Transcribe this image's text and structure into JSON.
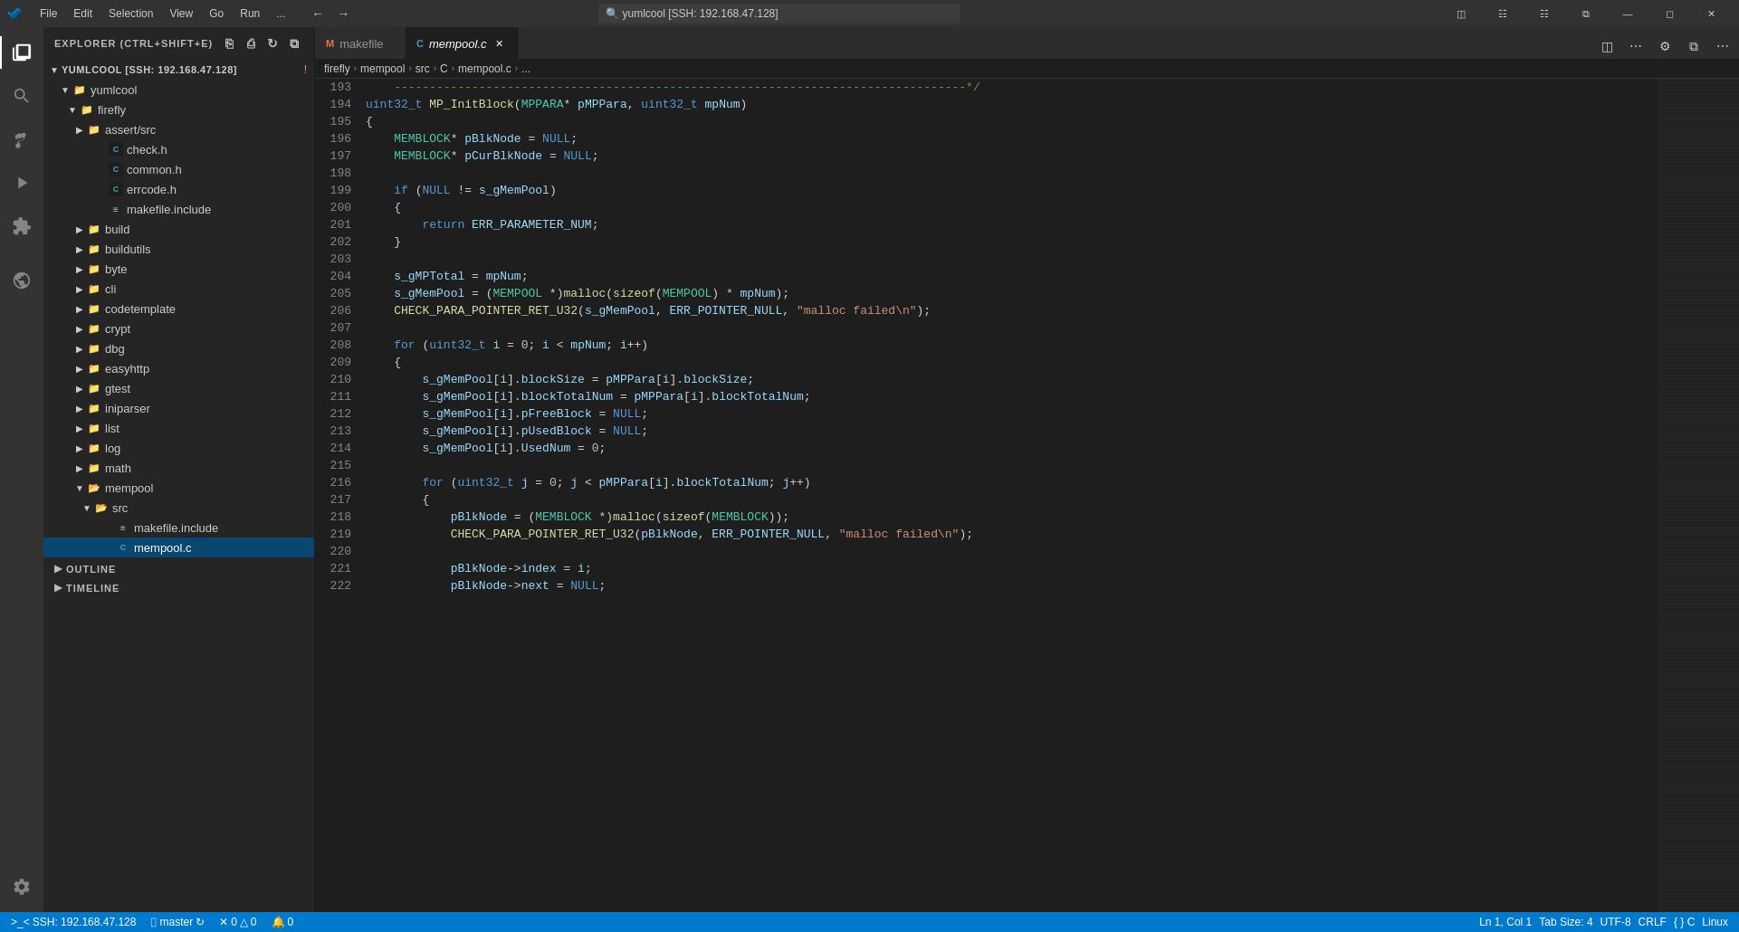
{
  "titlebar": {
    "app_icon": "VSCode",
    "menu": [
      "File",
      "Edit",
      "Selection",
      "View",
      "Go",
      "Run",
      "..."
    ],
    "search_text": "yumlcool [SSH: 192.168.47.128]",
    "window_controls": [
      "minimize",
      "maximize",
      "restore",
      "close"
    ]
  },
  "activity_bar": {
    "icons": [
      "explorer",
      "search",
      "source-control",
      "run-debug",
      "extensions",
      "remote-explorer",
      "settings"
    ]
  },
  "sidebar": {
    "title": "Explorer (Ctrl+Shift+E)",
    "root": "YUMLCOOL [SSH: 192.168.47.128]",
    "actions": [
      "new-file",
      "new-folder",
      "refresh",
      "collapse"
    ],
    "tree": [
      {
        "label": "yumlcool",
        "type": "folder",
        "expanded": true,
        "depth": 1
      },
      {
        "label": "firefly",
        "type": "folder",
        "expanded": true,
        "depth": 2
      },
      {
        "label": "assert/src",
        "type": "folder",
        "expanded": false,
        "depth": 3
      },
      {
        "label": "check.h",
        "type": "c-file",
        "depth": 4
      },
      {
        "label": "common.h",
        "type": "c-file",
        "depth": 4
      },
      {
        "label": "errcode.h",
        "type": "c-file",
        "depth": 4
      },
      {
        "label": "makefile.include",
        "type": "makefile",
        "depth": 4
      },
      {
        "label": "build",
        "type": "folder",
        "expanded": false,
        "depth": 3
      },
      {
        "label": "buildutils",
        "type": "folder",
        "expanded": false,
        "depth": 3
      },
      {
        "label": "byte",
        "type": "folder",
        "expanded": false,
        "depth": 3
      },
      {
        "label": "cli",
        "type": "folder",
        "expanded": false,
        "depth": 3
      },
      {
        "label": "codetemplate",
        "type": "folder",
        "expanded": false,
        "depth": 3
      },
      {
        "label": "crypt",
        "type": "folder",
        "expanded": false,
        "depth": 3
      },
      {
        "label": "dbg",
        "type": "folder",
        "expanded": false,
        "depth": 3
      },
      {
        "label": "easyhttp",
        "type": "folder",
        "expanded": false,
        "depth": 3
      },
      {
        "label": "gtest",
        "type": "folder",
        "expanded": false,
        "depth": 3
      },
      {
        "label": "iniparser",
        "type": "folder",
        "expanded": false,
        "depth": 3
      },
      {
        "label": "list",
        "type": "folder",
        "expanded": false,
        "depth": 3
      },
      {
        "label": "log",
        "type": "folder",
        "expanded": false,
        "depth": 3
      },
      {
        "label": "math",
        "type": "folder",
        "expanded": false,
        "depth": 3
      },
      {
        "label": "mempool",
        "type": "folder",
        "expanded": true,
        "depth": 3
      },
      {
        "label": "src",
        "type": "folder",
        "expanded": true,
        "depth": 4
      },
      {
        "label": "makefile.include",
        "type": "makefile",
        "depth": 5
      },
      {
        "label": "mempool.c",
        "type": "c-file",
        "depth": 5,
        "selected": true
      }
    ],
    "outline": "OUTLINE",
    "timeline": "TIMELINE"
  },
  "tabs": [
    {
      "label": "makefile",
      "icon": "M",
      "active": false,
      "closeable": true
    },
    {
      "label": "mempool.c",
      "icon": "C",
      "active": true,
      "closeable": true
    }
  ],
  "breadcrumb": [
    "firefly",
    "mempool",
    "src",
    "C",
    "mempool.c",
    "..."
  ],
  "editor": {
    "lines": [
      {
        "num": 193,
        "code": "    <cm>---------------------------------------------------------------------------------*/</cm>"
      },
      {
        "num": 194,
        "code": "<kw>uint32_t</kw> <fn>MP_InitBlock</fn>(<ty>MPPARA</ty>* <vr>pMPPara</vr>, <kw>uint32_t</kw> <vr>mpNum</vr>)"
      },
      {
        "num": 195,
        "code": "{"
      },
      {
        "num": 196,
        "code": "    <ty>MEMBLOCK</ty>* <vr>pBlkNode</vr> = <kw>NULL</kw>;"
      },
      {
        "num": 197,
        "code": "    <ty>MEMBLOCK</ty>* <vr>pCurBlkNode</vr> = <kw>NULL</kw>;"
      },
      {
        "num": 198,
        "code": ""
      },
      {
        "num": 199,
        "code": "    <kw>if</kw> (<kw>NULL</kw> != <vr>s_gMemPool</vr>)"
      },
      {
        "num": 200,
        "code": "    {"
      },
      {
        "num": 201,
        "code": "        <kw>return</kw> <vr>ERR_PARAMETER_NUM</vr>;"
      },
      {
        "num": 202,
        "code": "    }"
      },
      {
        "num": 203,
        "code": ""
      },
      {
        "num": 204,
        "code": "    <vr>s_gMPTotal</vr> = <vr>mpNum</vr>;"
      },
      {
        "num": 205,
        "code": "    <vr>s_gMemPool</vr> = (<ty>MEMPOOL</ty> *)<fn>malloc</fn>(<fn>sizeof</fn>(<ty>MEMPOOL</ty>) * <vr>mpNum</vr>);"
      },
      {
        "num": 206,
        "code": "    <mac>CHECK_PARA_POINTER_RET_U32</mac>(<vr>s_gMemPool</vr>, <vr>ERR_POINTER_NULL</vr>, <str>\"malloc failed\\n\"</str>);"
      },
      {
        "num": 207,
        "code": ""
      },
      {
        "num": 208,
        "code": "    <kw>for</kw> (<kw>uint32_t</kw> <vr>i</vr> = <num>0</num>; <vr>i</vr> &lt; <vr>mpNum</vr>; <vr>i</vr>++)"
      },
      {
        "num": 209,
        "code": "    {"
      },
      {
        "num": 210,
        "code": "        <vr>s_gMemPool</vr>[<vr>i</vr>].<vr>blockSize</vr> = <vr>pMPPara</vr>[<vr>i</vr>].<vr>blockSize</vr>;"
      },
      {
        "num": 211,
        "code": "        <vr>s_gMemPool</vr>[<vr>i</vr>].<vr>blockTotalNum</vr> = <vr>pMPPara</vr>[<vr>i</vr>].<vr>blockTotalNum</vr>;"
      },
      {
        "num": 212,
        "code": "        <vr>s_gMemPool</vr>[<vr>i</vr>].<vr>pFreeBlock</vr> = <kw>NULL</kw>;"
      },
      {
        "num": 213,
        "code": "        <vr>s_gMemPool</vr>[<vr>i</vr>].<vr>pUsedBlock</vr> = <kw>NULL</kw>;"
      },
      {
        "num": 214,
        "code": "        <vr>s_gMemPool</vr>[<vr>i</vr>].<vr>UsedNum</vr> = <num>0</num>;"
      },
      {
        "num": 215,
        "code": ""
      },
      {
        "num": 216,
        "code": "        <kw>for</kw> (<kw>uint32_t</kw> <vr>j</vr> = <num>0</num>; <vr>j</vr> &lt; <vr>pMPPara</vr>[<vr>i</vr>].<vr>blockTotalNum</vr>; <vr>j</vr>++)"
      },
      {
        "num": 217,
        "code": "        {"
      },
      {
        "num": 218,
        "code": "            <vr>pBlkNode</vr> = (<ty>MEMBLOCK</ty> *)<fn>malloc</fn>(<fn>sizeof</fn>(<ty>MEMBLOCK</ty>));"
      },
      {
        "num": 219,
        "code": "            <mac>CHECK_PARA_POINTER_RET_U32</mac>(<vr>pBlkNode</vr>, <vr>ERR_POINTER_NULL</vr>, <str>\"malloc failed\\n\"</str>);"
      },
      {
        "num": 220,
        "code": ""
      },
      {
        "num": 221,
        "code": "            <vr>pBlkNode</vr>-&gt;<vr>index</vr> = <vr>i</vr>;"
      },
      {
        "num": 222,
        "code": "            <vr>pBlkNode</vr>-&gt;<vr>next</vr> = <kw>NULL</kw>;"
      }
    ]
  },
  "statusbar": {
    "ssh": "SSH: 192.168.47.128",
    "branch": "master",
    "sync": "sync",
    "errors": "0",
    "warnings": "0",
    "notifications": "0",
    "position": "Ln 1, Col 1",
    "tab_size": "Tab Size: 4",
    "encoding": "UTF-8",
    "line_ending": "CRLF",
    "scope": "{ } C",
    "os": "Linux"
  }
}
